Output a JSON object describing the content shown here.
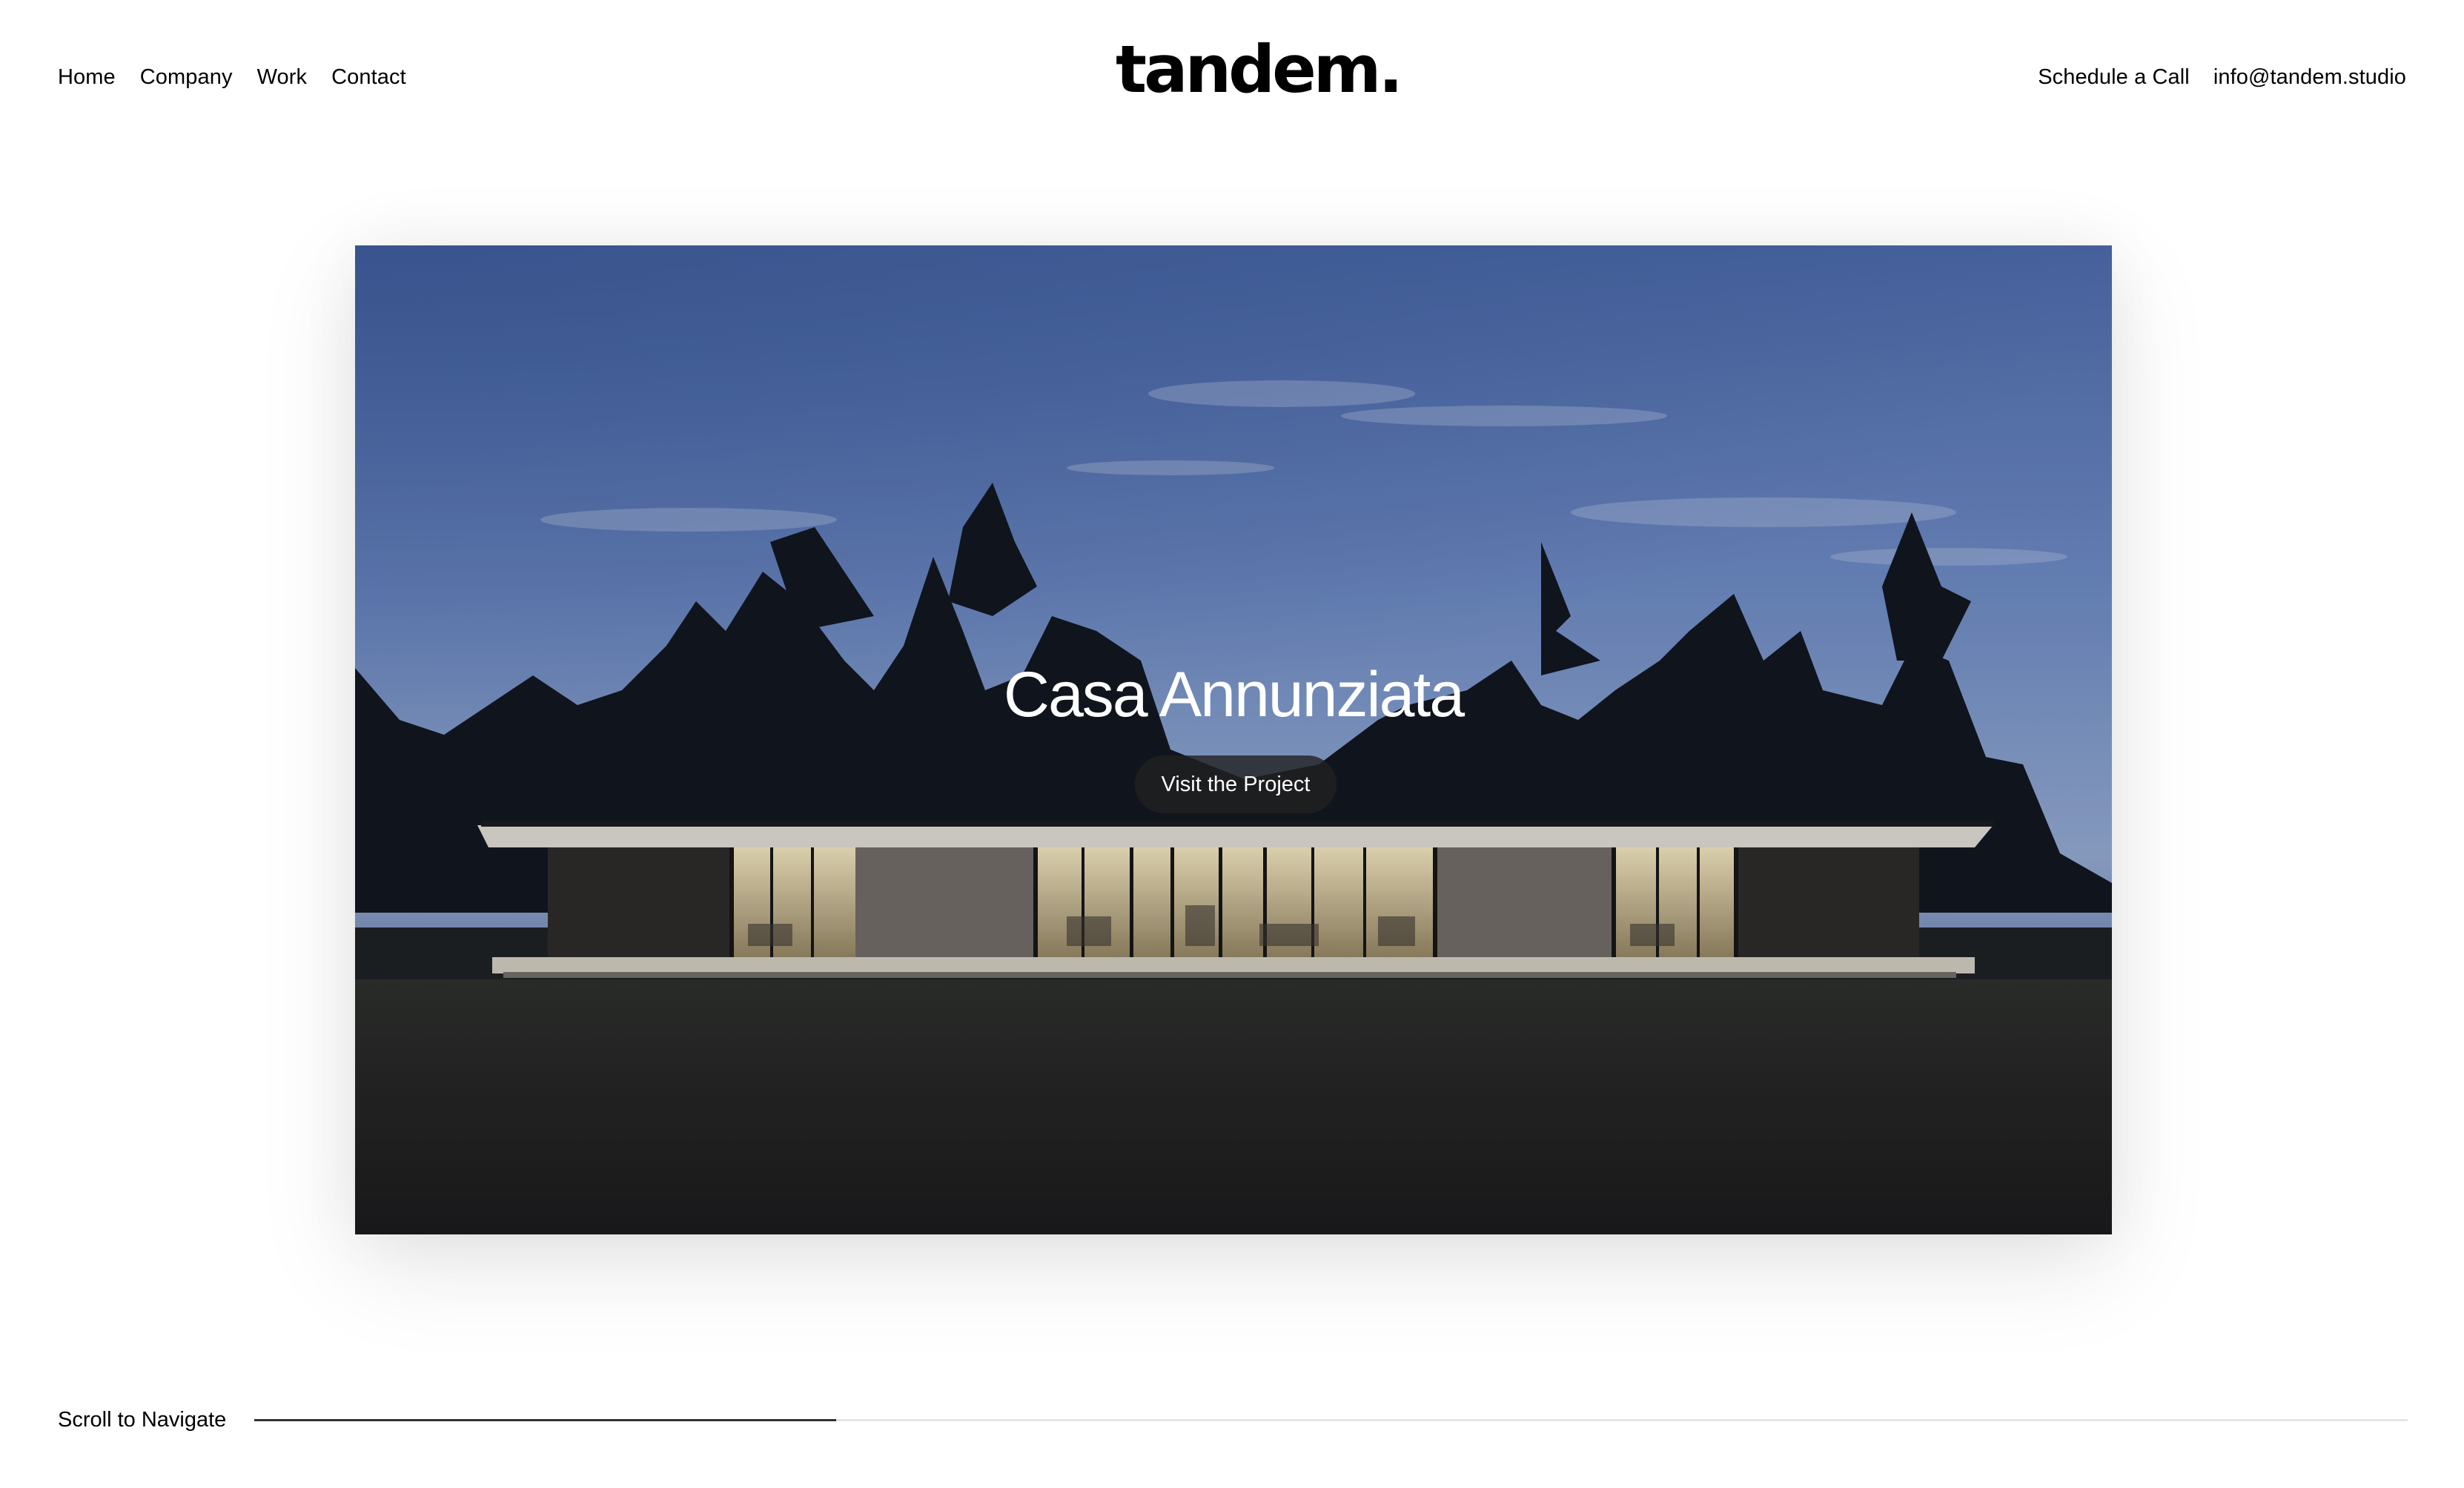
{
  "header": {
    "nav": [
      "Home",
      "Company",
      "Work",
      "Contact"
    ],
    "logo": "tandem.",
    "schedule_label": "Schedule a Call",
    "email": "info@tandem.studio"
  },
  "hero": {
    "title": "Casa Annunziata",
    "cta_label": "Visit the Project",
    "image_alt_icon": "modern-house-photo"
  },
  "footer": {
    "scroll_label": "Scroll to Navigate",
    "scroll_progress": 0.27
  },
  "colors": {
    "text": "#000000",
    "background": "#ffffff",
    "button_bg": "#202020",
    "track": "#e4e4e4",
    "track_fill": "#333333"
  }
}
